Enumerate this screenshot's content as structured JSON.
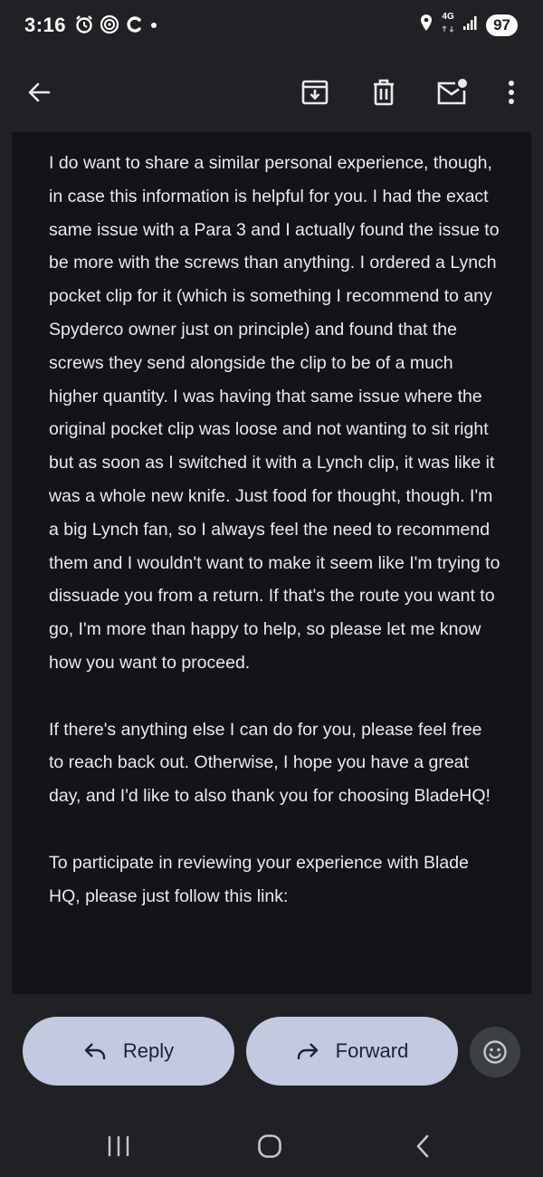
{
  "status_bar": {
    "time": "3:16",
    "network": "4G",
    "battery": "97",
    "icons": [
      "alarm-icon",
      "tinder-icon",
      "c-app-icon",
      "dot-icon",
      "location-icon",
      "signal-icon"
    ]
  },
  "toolbar": {
    "icons": [
      "back-arrow-icon",
      "archive-icon",
      "delete-icon",
      "mark-unread-icon",
      "more-icon"
    ]
  },
  "email": {
    "paragraphs": [
      "I do want to share a similar personal experience, though, in case this information is helpful for you. I had the exact same issue with a Para 3 and I actually found the issue to be more with the screws than anything. I ordered a Lynch pocket clip for it (which is something I recommend to any Spyderco owner just on principle) and found that the screws they send alongside the clip to be of a much higher quantity. I was having that same issue where the original pocket clip was loose and not wanting to sit right but as soon as I switched it with a Lynch clip, it was like it was a whole new knife. Just food for thought, though. I'm a big Lynch fan, so I always feel the need to recommend them and I wouldn't want to make it seem like I'm trying to dissuade you from a return. If that's the route you want to go, I'm more than happy to help, so please let me know how you want to proceed.",
      "If there's anything else I can do for you, please feel free to reach back out. Otherwise, I hope you have a great day, and I'd like to also thank you for choosing BladeHQ!",
      "To participate in reviewing your experience with Blade HQ, please just follow this link:"
    ]
  },
  "actions": {
    "reply_label": "Reply",
    "forward_label": "Forward"
  },
  "colors": {
    "background": "#202124",
    "body_background": "#121418",
    "button_fill": "#c2c9e0"
  }
}
